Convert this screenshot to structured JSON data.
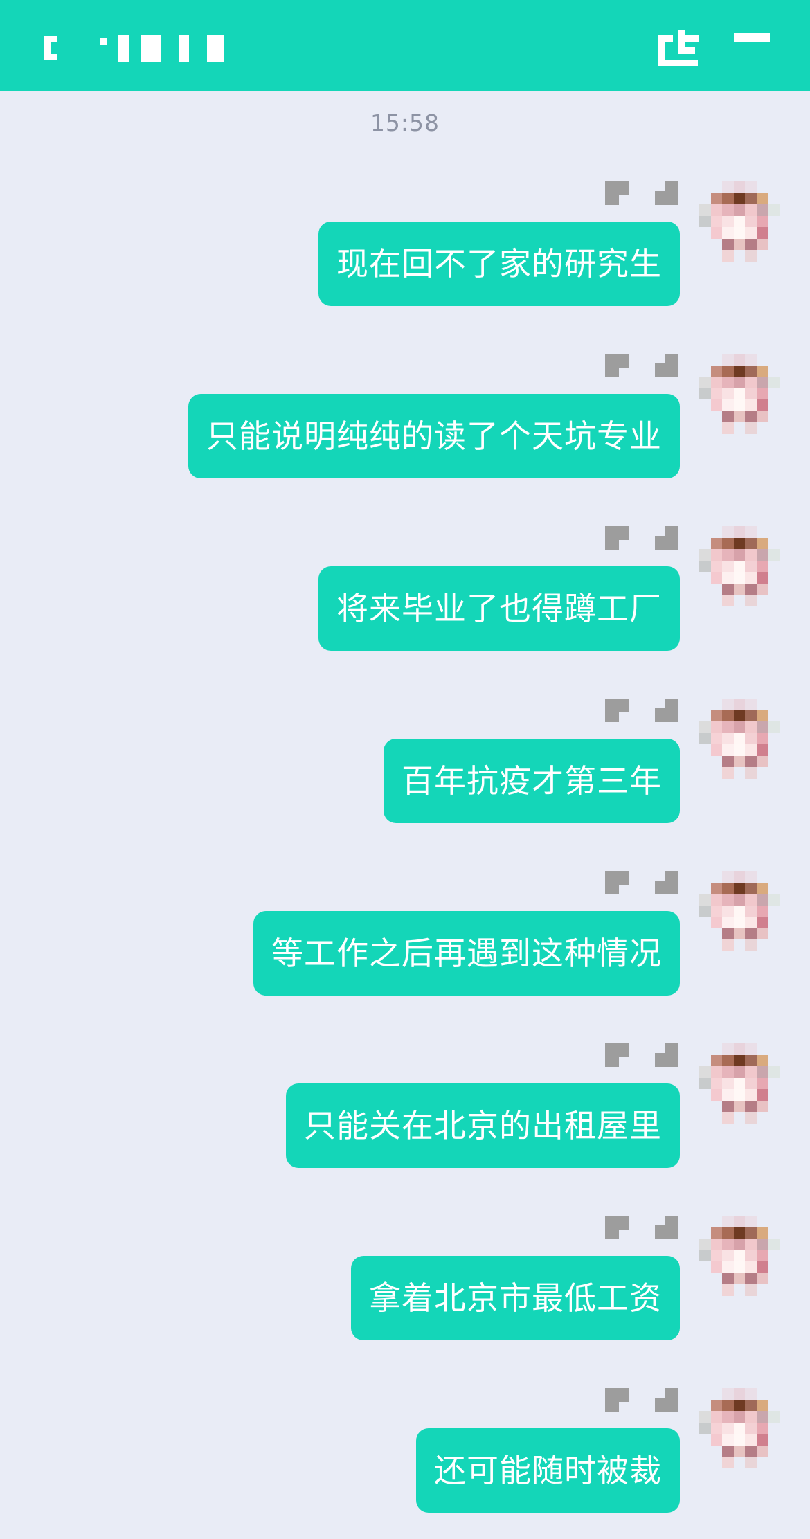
{
  "header": {
    "back_icon": "back-icon",
    "share_icon": "share-icon",
    "menu_icon": "menu-icon",
    "background": "#14d6b8"
  },
  "timestamp": "15:58",
  "messages": [
    {
      "text": "现在回不了家的研究生"
    },
    {
      "text": "只能说明纯纯的读了个天坑专业"
    },
    {
      "text": "将来毕业了也得蹲工厂"
    },
    {
      "text": "百年抗疫才第三年"
    },
    {
      "text": "等工作之后再遇到这种情况"
    },
    {
      "text": "只能关在北京的出租屋里"
    },
    {
      "text": "拿着北京市最低工资"
    },
    {
      "text": "还可能随时被裁"
    }
  ],
  "colors": {
    "accent": "#14d6b8",
    "background": "#e9ecf6",
    "timestamp": "#8d93a4"
  }
}
